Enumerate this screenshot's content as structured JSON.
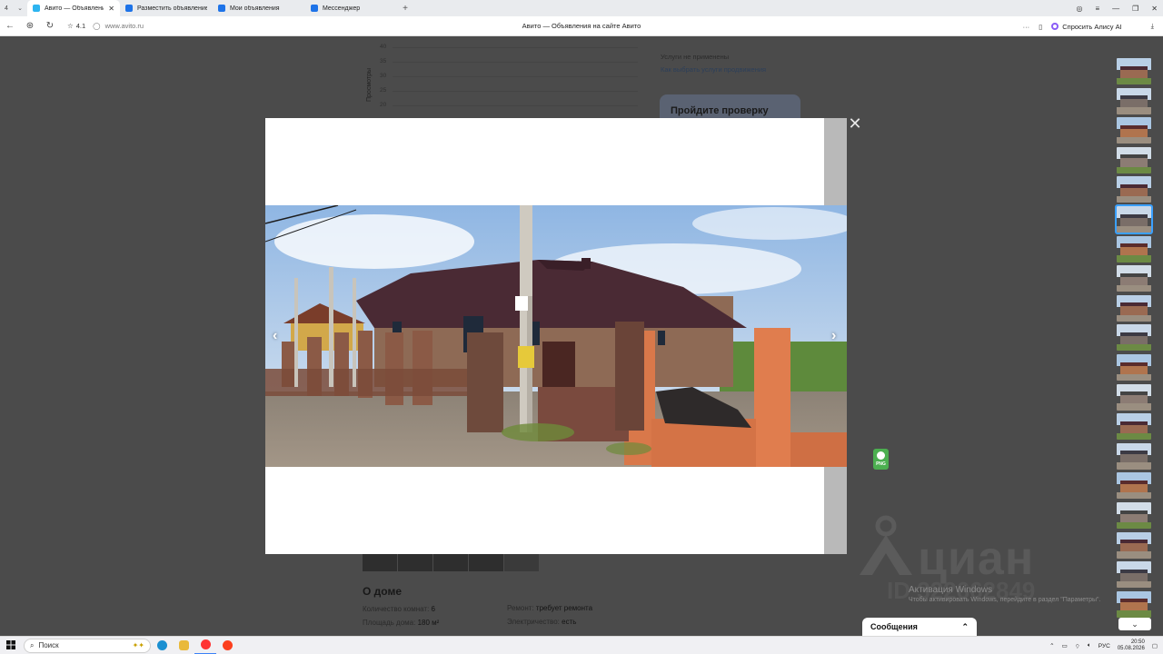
{
  "browser": {
    "tab_count": "4",
    "tabs": [
      {
        "label": "Авито — Объявления",
        "active": true,
        "fav_color": "#2db4f0"
      },
      {
        "label": "Разместить объявление",
        "active": false,
        "fav_color": "#1e73e8"
      },
      {
        "label": "Мои объявления",
        "active": false,
        "fav_color": "#1e73e8"
      },
      {
        "label": "Мессенджер",
        "active": false,
        "fav_color": "#1e73e8"
      }
    ],
    "rating": "4.1",
    "url": "www.avito.ru",
    "page_title": "Авито — Объявления на сайте Авито",
    "alice_label": "Спросить Алису AI"
  },
  "page": {
    "chart": {
      "ylabel": "Просмотры",
      "ticks": [
        "40",
        "35",
        "30",
        "25",
        "20"
      ]
    },
    "promo": {
      "line1": "Услуги не применены",
      "link": "Как выбрать услуги продвижения",
      "verify_title": "Пройдите проверку"
    },
    "about": {
      "title": "О доме",
      "col1": [
        {
          "label": "Количество комнат:",
          "value": "6"
        },
        {
          "label": "Площадь дома:",
          "value": "180 м²"
        }
      ],
      "col2": [
        {
          "label": "Ремонт:",
          "value": "требует ремонта"
        },
        {
          "label": "Электричество:",
          "value": "есть"
        }
      ]
    },
    "watermark": {
      "brand": "циан",
      "id": "ID 322662849"
    },
    "windows_activation": {
      "title": "Активация Windows",
      "subtitle": "Чтобы активировать Windows, перейдите в раздел \"Параметры\"."
    },
    "messages_label": "Сообщения",
    "png_label": "PNG"
  },
  "viewer": {
    "close_icon": "close-icon",
    "prev_icon": "chevron-left-icon",
    "next_icon": "chevron-right-icon",
    "selected_thumb_index": 5,
    "thumbnail_count": 19
  },
  "taskbar": {
    "search_placeholder": "Поиск",
    "lang": "РУС",
    "time": "20:50",
    "date": "05.08.2026"
  },
  "colors": {
    "brick": "#a86a4a",
    "roof": "#4a2a34",
    "sky": "#a9c9ea",
    "accent": "#3aa0ff"
  }
}
